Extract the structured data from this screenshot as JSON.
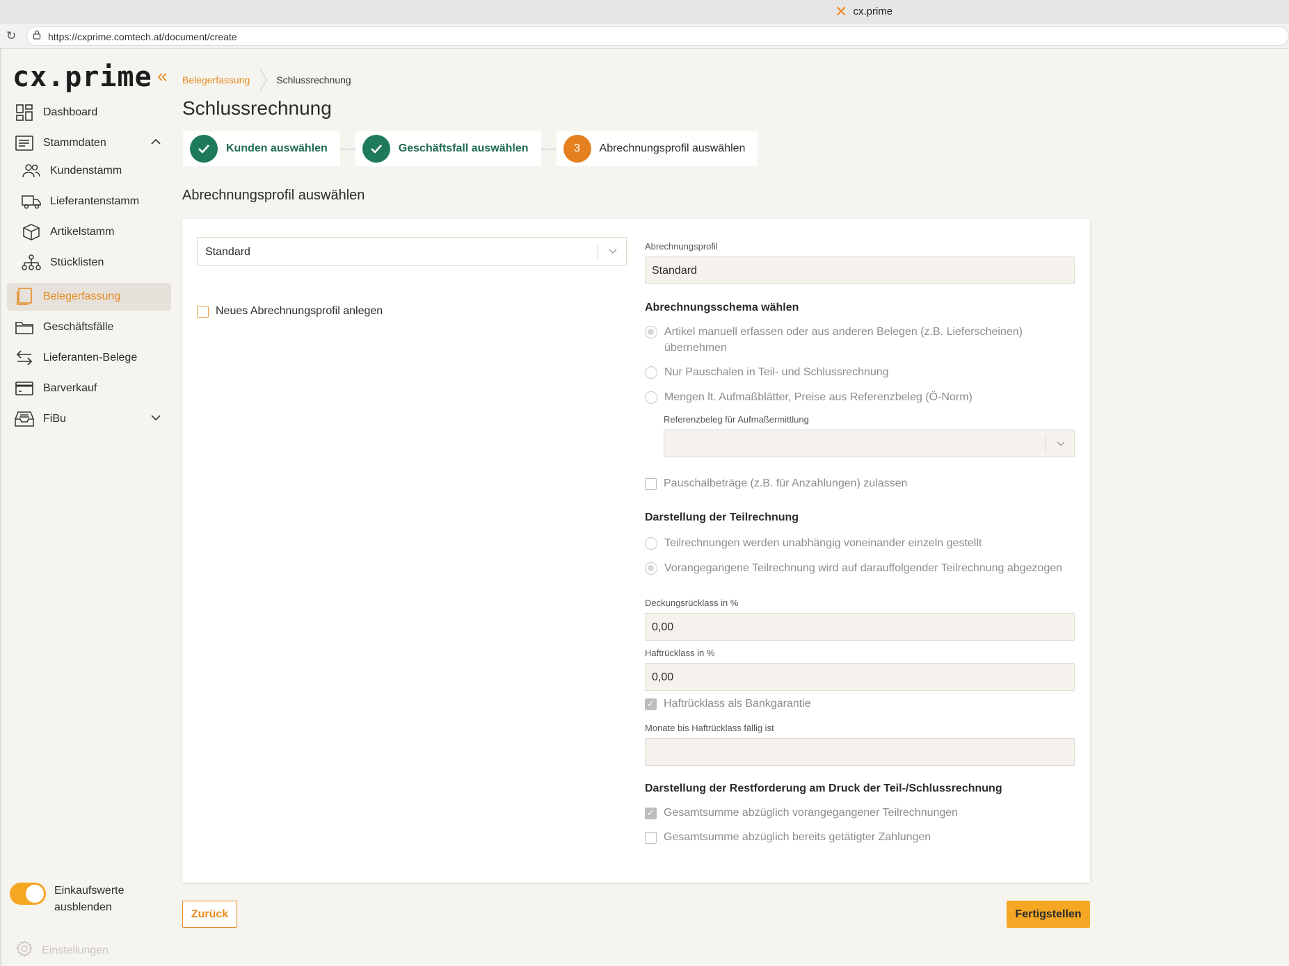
{
  "browser": {
    "tab_title": "cx.prime",
    "url": "https://cxprime.comtech.at/document/create"
  },
  "sidebar": {
    "logo": "cx.prime",
    "items": [
      {
        "label": "Dashboard",
        "icon": "dashboard-icon"
      },
      {
        "label": "Stammdaten",
        "icon": "list-icon"
      },
      {
        "label": "Kundenstamm",
        "icon": "users-icon"
      },
      {
        "label": "Lieferantenstamm",
        "icon": "truck-icon"
      },
      {
        "label": "Artikelstamm",
        "icon": "box-icon"
      },
      {
        "label": "Stücklisten",
        "icon": "hierarchy-icon"
      },
      {
        "label": "Belegerfassung",
        "icon": "document-icon"
      },
      {
        "label": "Geschäftsfälle",
        "icon": "folder-icon"
      },
      {
        "label": "Lieferanten-Belege",
        "icon": "arrows-icon"
      },
      {
        "label": "Barverkauf",
        "icon": "card-icon"
      },
      {
        "label": "FiBu",
        "icon": "inbox-icon"
      }
    ],
    "toggle_label": "Einkaufswerte ausblenden",
    "settings_label": "Einstellungen"
  },
  "breadcrumb": {
    "link": "Belegerfassung",
    "current": "Schlussrechnung"
  },
  "page_title": "Schlussrechnung",
  "steps": [
    {
      "label": "Kunden auswählen",
      "status": "done"
    },
    {
      "label": "Geschäftsfall auswählen",
      "status": "done"
    },
    {
      "number": "3",
      "label": "Abrechnungsprofil auswählen",
      "status": "current"
    }
  ],
  "section_title": "Abrechnungsprofil auswählen",
  "left": {
    "profile_select_value": "Standard",
    "new_profile_label": "Neues Abrechnungsprofil anlegen"
  },
  "right": {
    "profile_label": "Abrechnungsprofil",
    "profile_value": "Standard",
    "schema_title": "Abrechnungsschema wählen",
    "schema_options": [
      "Artikel manuell erfassen oder aus anderen Belegen (z.B. Lieferscheinen) übernehmen",
      "Nur Pauschalen in Teil- und Schlussrechnung",
      "Mengen lt. Aufmaßblätter, Preise aus Referenzbeleg (Ö-Norm)"
    ],
    "reference_label": "Referenzbeleg für Aufmaßermittlung",
    "flat_amounts_label": "Pauschalbeträge (z.B. für Anzahlungen) zulassen",
    "partial_title": "Darstellung der Teilrechnung",
    "partial_options": [
      "Teilrechnungen werden unabhängig voneinander einzeln gestellt",
      "Vorangegangene Teilrechnung wird auf darauffolgender Teilrechnung abgezogen"
    ],
    "coverage_label": "Deckungsrücklass in %",
    "coverage_value": "0,00",
    "liability_label": "Haftrücklass in %",
    "liability_value": "0,00",
    "bank_guarantee_label": "Haftrücklass als Bankgarantie",
    "months_label": "Monate bis Haftrücklass fällig ist",
    "months_value": "",
    "remaining_title": "Darstellung der Restforderung am Druck der Teil-/Schlussrechnung",
    "remaining_options": [
      "Gesamtsumme abzüglich vorangegangener Teilrechnungen",
      "Gesamtsumme abzüglich bereits getätigter Zahlungen"
    ]
  },
  "buttons": {
    "back": "Zurück",
    "finish": "Fertigstellen"
  },
  "colors": {
    "accent": "#e58a1f",
    "primary_button": "#f5a623",
    "step_done": "#1f7a5a",
    "step_current": "#e5801f"
  }
}
